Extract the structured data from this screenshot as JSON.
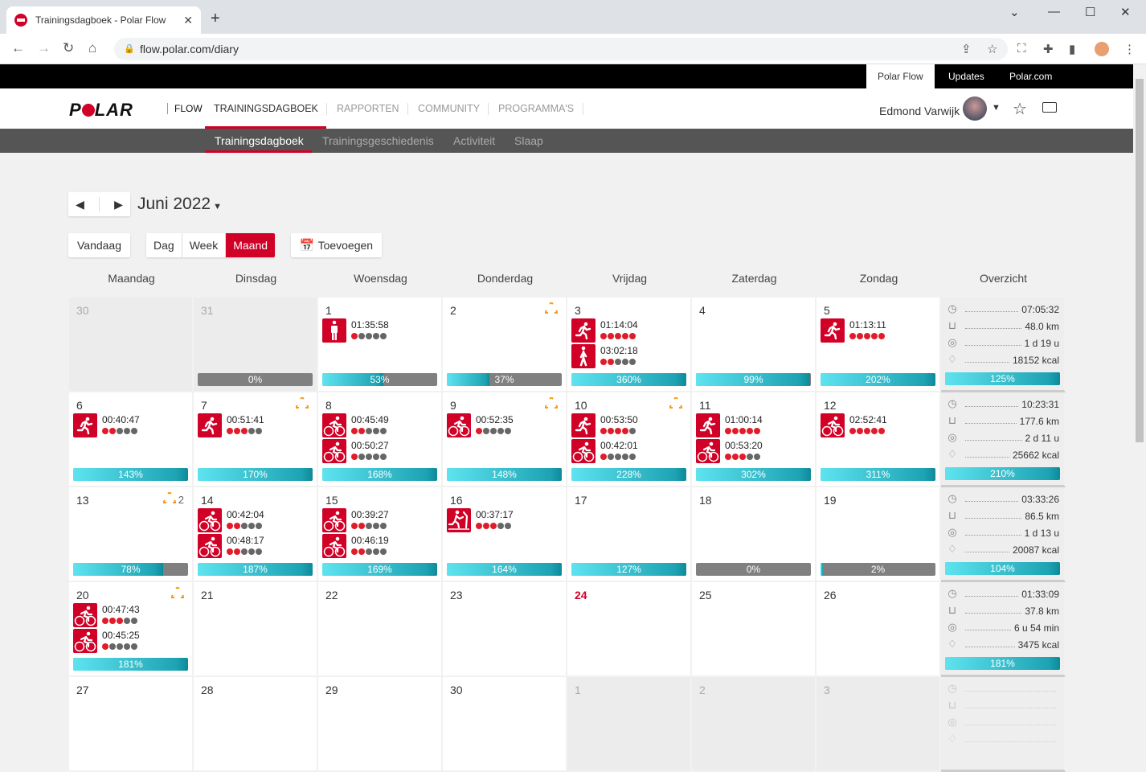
{
  "browser": {
    "tab_title": "Trainingsdagboek - Polar Flow",
    "url": "flow.polar.com/diary"
  },
  "top_links": [
    "Polar Flow",
    "Updates",
    "Polar.com"
  ],
  "header": {
    "flow": "FLOW",
    "nav": [
      "TRAININGSDAGBOEK",
      "RAPPORTEN",
      "COMMUNITY",
      "PROGRAMMA'S"
    ],
    "user": "Edmond Varwijk"
  },
  "subnav": [
    "Trainingsdagboek",
    "Trainingsgeschiedenis",
    "Activiteit",
    "Slaap"
  ],
  "toolbar": {
    "month": "Juni 2022",
    "today": "Vandaag",
    "views": [
      "Dag",
      "Week",
      "Maand"
    ],
    "active_view": "Maand",
    "add": "Toevoegen"
  },
  "day_headers": [
    "Maandag",
    "Dinsdag",
    "Woensdag",
    "Donderdag",
    "Vrijdag",
    "Zaterdag",
    "Zondag",
    "Overzicht"
  ],
  "colors": {
    "accent": "#d10027",
    "progress": "#1ea3b3"
  },
  "weeks": [
    {
      "days": [
        {
          "num": "30",
          "muted": true
        },
        {
          "num": "31",
          "muted": true,
          "progress": 0,
          "label": "0%"
        },
        {
          "num": "1",
          "sessions": [
            {
              "sport": "other",
              "time": "01:35:58",
              "dots": 1
            }
          ],
          "progress": 53,
          "label": "53%"
        },
        {
          "num": "2",
          "warning": true,
          "progress": 37,
          "label": "37%"
        },
        {
          "num": "3",
          "sessions": [
            {
              "sport": "run",
              "time": "01:14:04",
              "dots": 5
            },
            {
              "sport": "walk",
              "time": "03:02:18",
              "dots": 2
            }
          ],
          "progress": 360,
          "label": "360%"
        },
        {
          "num": "4",
          "progress": 99,
          "label": "99%"
        },
        {
          "num": "5",
          "sessions": [
            {
              "sport": "run",
              "time": "01:13:11",
              "dots": 5
            }
          ],
          "progress": 202,
          "label": "202%"
        }
      ],
      "summary": {
        "duration": "07:05:32",
        "distance": "48.0 km",
        "active": "1 d 19 u",
        "calories": "18152 kcal",
        "progress": 125,
        "label": "125%"
      }
    },
    {
      "days": [
        {
          "num": "6",
          "sessions": [
            {
              "sport": "run",
              "time": "00:40:47",
              "dots": 2
            }
          ],
          "progress": 143,
          "label": "143%"
        },
        {
          "num": "7",
          "warning": true,
          "sessions": [
            {
              "sport": "run",
              "time": "00:51:41",
              "dots": 3
            }
          ],
          "progress": 170,
          "label": "170%"
        },
        {
          "num": "8",
          "sessions": [
            {
              "sport": "bike",
              "time": "00:45:49",
              "dots": 2
            },
            {
              "sport": "bike",
              "time": "00:50:27",
              "dots": 1
            }
          ],
          "progress": 168,
          "label": "168%"
        },
        {
          "num": "9",
          "warning": true,
          "sessions": [
            {
              "sport": "bike",
              "time": "00:52:35",
              "dots": 1
            }
          ],
          "progress": 148,
          "label": "148%"
        },
        {
          "num": "10",
          "warning": true,
          "sessions": [
            {
              "sport": "run",
              "time": "00:53:50",
              "dots": 4
            },
            {
              "sport": "bike",
              "time": "00:42:01",
              "dots": 1
            }
          ],
          "progress": 228,
          "label": "228%"
        },
        {
          "num": "11",
          "sessions": [
            {
              "sport": "run",
              "time": "01:00:14",
              "dots": 5
            },
            {
              "sport": "bike",
              "time": "00:53:20",
              "dots": 3
            }
          ],
          "progress": 302,
          "label": "302%"
        },
        {
          "num": "12",
          "sessions": [
            {
              "sport": "bike",
              "time": "02:52:41",
              "dots": 5
            }
          ],
          "progress": 311,
          "label": "311%"
        }
      ],
      "summary": {
        "duration": "10:23:31",
        "distance": "177.6 km",
        "active": "2 d 11 u",
        "calories": "25662 kcal",
        "progress": 210,
        "label": "210%"
      }
    },
    {
      "days": [
        {
          "num": "13",
          "warning": true,
          "warning_count": "2",
          "progress": 78,
          "label": "78%"
        },
        {
          "num": "14",
          "sessions": [
            {
              "sport": "bike",
              "time": "00:42:04",
              "dots": 2
            },
            {
              "sport": "bike",
              "time": "00:48:17",
              "dots": 2
            }
          ],
          "progress": 187,
          "label": "187%"
        },
        {
          "num": "15",
          "sessions": [
            {
              "sport": "bike",
              "time": "00:39:27",
              "dots": 2
            },
            {
              "sport": "bike",
              "time": "00:46:19",
              "dots": 2
            }
          ],
          "progress": 169,
          "label": "169%"
        },
        {
          "num": "16",
          "sessions": [
            {
              "sport": "treadmill",
              "time": "00:37:17",
              "dots": 3
            }
          ],
          "progress": 164,
          "label": "164%"
        },
        {
          "num": "17",
          "progress": 127,
          "label": "127%"
        },
        {
          "num": "18",
          "progress": 0,
          "label": "0%"
        },
        {
          "num": "19",
          "progress": 2,
          "label": "2%"
        }
      ],
      "summary": {
        "duration": "03:33:26",
        "distance": "86.5 km",
        "active": "1 d 13 u",
        "calories": "20087 kcal",
        "progress": 104,
        "label": "104%"
      }
    },
    {
      "days": [
        {
          "num": "20",
          "warning": true,
          "sessions": [
            {
              "sport": "bike",
              "time": "00:47:43",
              "dots": 3
            },
            {
              "sport": "bike",
              "time": "00:45:25",
              "dots": 1
            }
          ],
          "progress": 181,
          "label": "181%"
        },
        {
          "num": "21"
        },
        {
          "num": "22"
        },
        {
          "num": "23"
        },
        {
          "num": "24",
          "today": true
        },
        {
          "num": "25"
        },
        {
          "num": "26"
        }
      ],
      "summary": {
        "duration": "01:33:09",
        "distance": "37.8 km",
        "active": "6 u 54 min",
        "calories": "3475 kcal",
        "progress": 181,
        "label": "181%"
      }
    },
    {
      "days": [
        {
          "num": "27"
        },
        {
          "num": "28"
        },
        {
          "num": "29"
        },
        {
          "num": "30"
        },
        {
          "num": "1",
          "muted": true
        },
        {
          "num": "2",
          "muted": true
        },
        {
          "num": "3",
          "muted": true
        }
      ],
      "summary": {
        "empty": true
      }
    }
  ]
}
